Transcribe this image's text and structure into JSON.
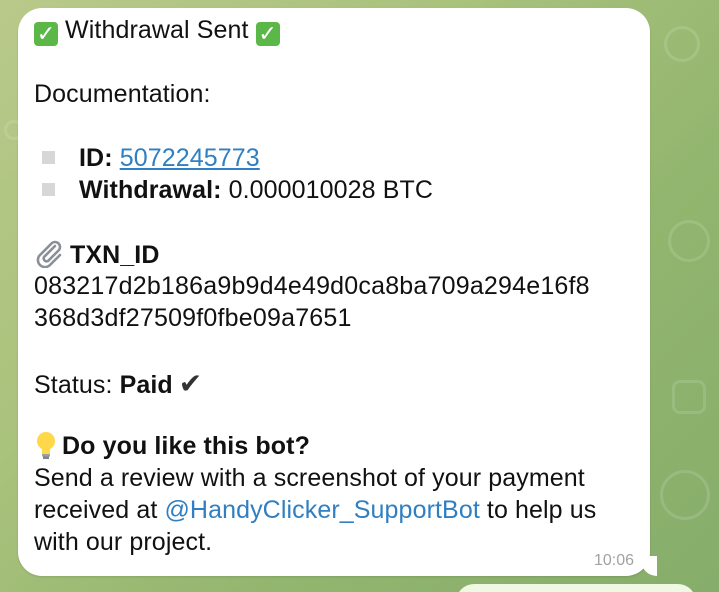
{
  "message": {
    "title": "Withdrawal Sent",
    "doc_label": "Documentation:",
    "id_label": "ID:",
    "id_value": "5072245773",
    "withdrawal_label": "Withdrawal:",
    "withdrawal_value": "0.000010028 BTC",
    "txn_label": "TXN_ID",
    "txn_line1": "083217d2b186a9b9d4e49d0ca8ba709a294e16f8",
    "txn_line2": "368d3df27509f0fbe09a7651",
    "status_label": "Status:",
    "status_value": "Paid",
    "question": "Do you like this bot?",
    "review_line1": "Send a review with a screenshot of your payment",
    "review_prefix": "received at ",
    "review_mention": "@HandyClicker_SupportBot",
    "review_suffix": " to help us",
    "review_line3": "with our project.",
    "time": "10:06"
  },
  "icons": {
    "title_left": "check-mark-button-emoji",
    "title_right": "check-mark-button-emoji",
    "txn": "paperclip-icon",
    "question": "light-bulb-icon",
    "status": "heavy-check-mark-icon"
  },
  "colors": {
    "link": "#2f7fc2",
    "bubble": "#ffffff",
    "check_emoji": "#5bb848"
  }
}
